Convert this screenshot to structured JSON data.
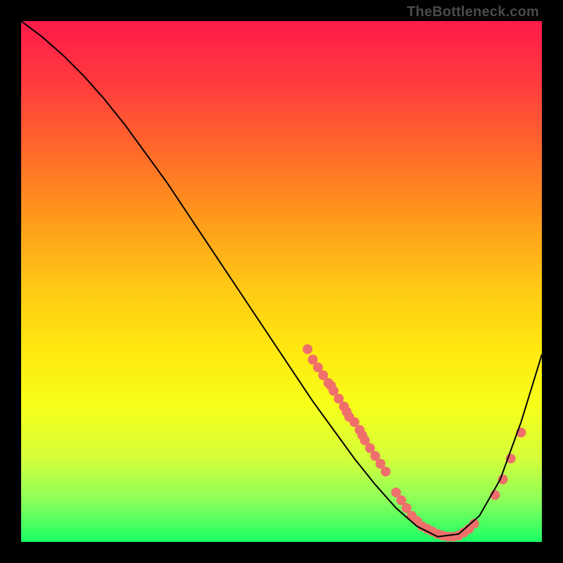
{
  "watermark": "TheBottleneck.com",
  "chart_data": {
    "type": "line",
    "title": "",
    "xlabel": "",
    "ylabel": "",
    "xlim": [
      0,
      100
    ],
    "ylim": [
      0,
      100
    ],
    "series": [
      {
        "name": "curve",
        "x": [
          0,
          4,
          8,
          12,
          16,
          20,
          24,
          28,
          32,
          36,
          40,
          44,
          48,
          52,
          56,
          60,
          64,
          68,
          72,
          76,
          80,
          84,
          88,
          92,
          96,
          100
        ],
        "y": [
          100,
          97,
          93.5,
          89.5,
          85,
          80,
          74.5,
          69,
          63,
          57,
          51,
          45,
          39,
          33,
          27,
          21.5,
          16,
          11,
          6.5,
          3,
          1,
          1.5,
          5,
          12,
          23,
          36
        ]
      }
    ],
    "markers": [
      {
        "x": 55,
        "y": 37
      },
      {
        "x": 56,
        "y": 35
      },
      {
        "x": 57,
        "y": 33.5
      },
      {
        "x": 58,
        "y": 32
      },
      {
        "x": 59,
        "y": 30.5
      },
      {
        "x": 59.5,
        "y": 30
      },
      {
        "x": 60,
        "y": 29
      },
      {
        "x": 61,
        "y": 27.5
      },
      {
        "x": 62,
        "y": 26
      },
      {
        "x": 62.5,
        "y": 25
      },
      {
        "x": 63,
        "y": 24
      },
      {
        "x": 64,
        "y": 23
      },
      {
        "x": 65,
        "y": 21.5
      },
      {
        "x": 65.5,
        "y": 20.5
      },
      {
        "x": 66,
        "y": 19.5
      },
      {
        "x": 67,
        "y": 18
      },
      {
        "x": 68,
        "y": 16.5
      },
      {
        "x": 69,
        "y": 15
      },
      {
        "x": 70,
        "y": 13.5
      },
      {
        "x": 72,
        "y": 9.5
      },
      {
        "x": 73,
        "y": 8
      },
      {
        "x": 74,
        "y": 6.5
      },
      {
        "x": 75,
        "y": 5
      },
      {
        "x": 76,
        "y": 4
      },
      {
        "x": 77,
        "y": 3
      },
      {
        "x": 78,
        "y": 2.5
      },
      {
        "x": 79,
        "y": 2
      },
      {
        "x": 80,
        "y": 1.5
      },
      {
        "x": 81,
        "y": 1.2
      },
      {
        "x": 82,
        "y": 1
      },
      {
        "x": 83,
        "y": 1
      },
      {
        "x": 84,
        "y": 1.2
      },
      {
        "x": 85,
        "y": 1.8
      },
      {
        "x": 86,
        "y": 2.5
      },
      {
        "x": 87,
        "y": 3.5
      },
      {
        "x": 91,
        "y": 9
      },
      {
        "x": 92.5,
        "y": 12
      },
      {
        "x": 94,
        "y": 16
      },
      {
        "x": 96,
        "y": 21
      }
    ],
    "marker_color": "#ef6f6b",
    "line_color": "#000000"
  }
}
